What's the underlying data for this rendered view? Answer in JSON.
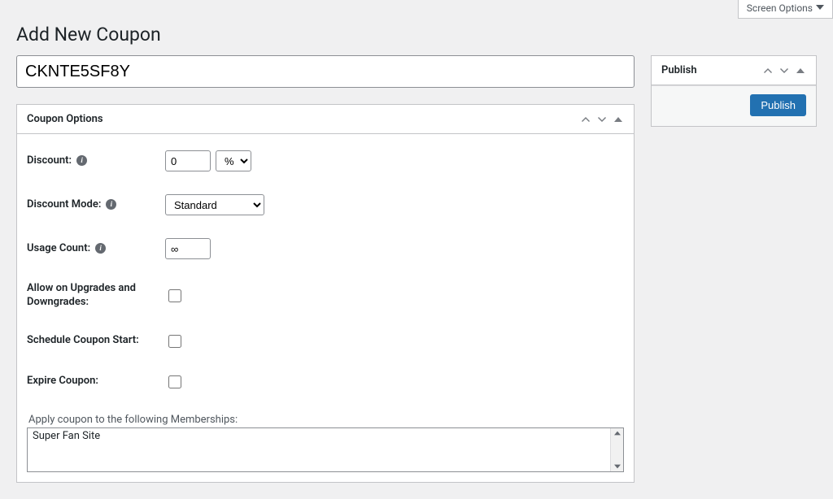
{
  "screen_options": "Screen Options",
  "page_title": "Add New Coupon",
  "coupon_code": "CKNTE5SF8Y",
  "coupon_options": {
    "title": "Coupon Options",
    "discount_label": "Discount:",
    "discount_value": "0",
    "discount_unit": "%",
    "mode_label": "Discount Mode:",
    "mode_value": "Standard",
    "usage_label": "Usage Count:",
    "usage_value": "∞",
    "allow_label": "Allow on Upgrades and Downgrades:",
    "schedule_label": "Schedule Coupon Start:",
    "expire_label": "Expire Coupon:",
    "membership_label": "Apply coupon to the following Memberships:",
    "membership_option": "Super Fan Site"
  },
  "publish": {
    "title": "Publish",
    "button": "Publish"
  }
}
